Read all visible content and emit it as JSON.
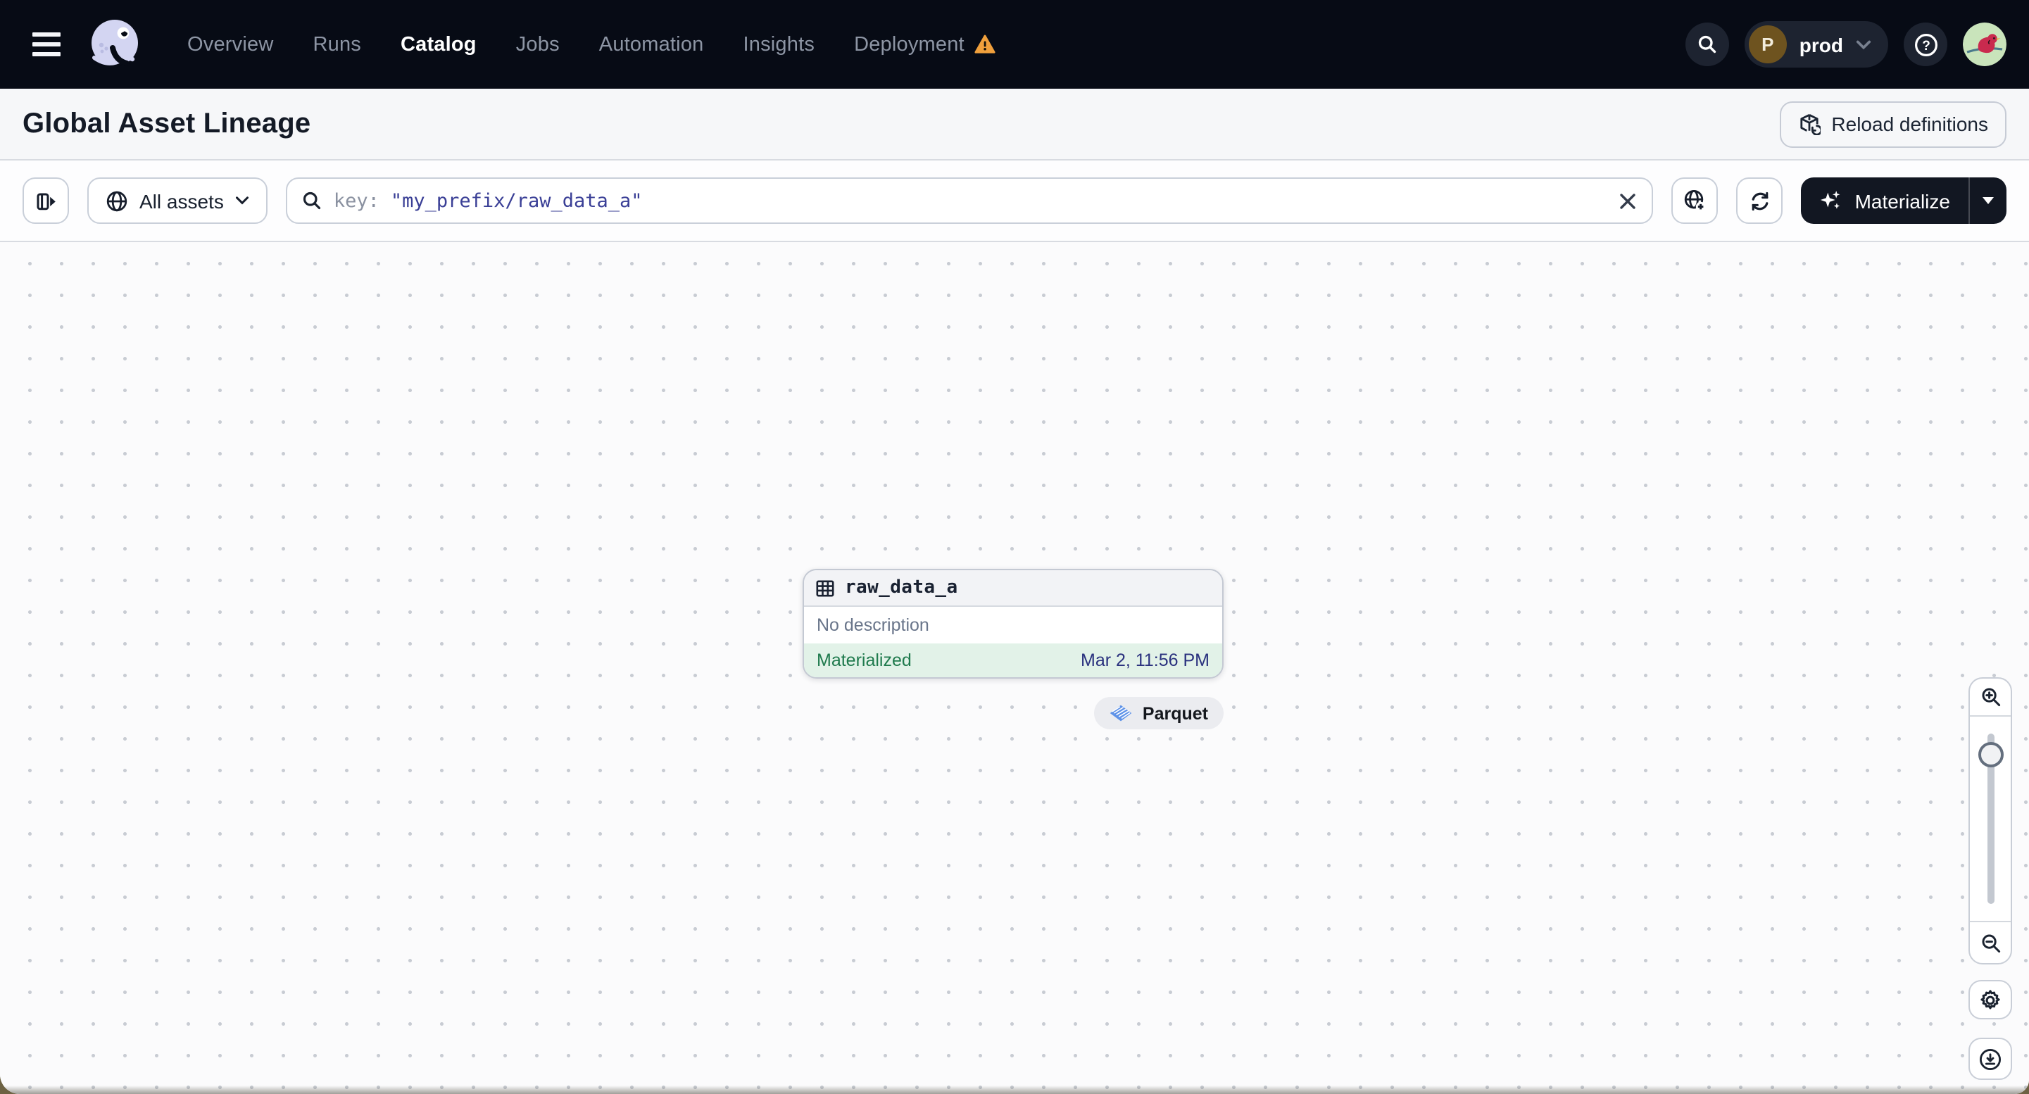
{
  "nav": {
    "links": [
      {
        "label": "Overview"
      },
      {
        "label": "Runs"
      },
      {
        "label": "Catalog"
      },
      {
        "label": "Jobs"
      },
      {
        "label": "Automation"
      },
      {
        "label": "Insights"
      },
      {
        "label": "Deployment"
      }
    ],
    "active_link": "Catalog",
    "env": {
      "initial": "P",
      "name": "prod"
    }
  },
  "header": {
    "title": "Global Asset Lineage",
    "reload_button_label": "Reload definitions"
  },
  "toolbar": {
    "filter_button_label": "All assets",
    "search_prefix": "key:",
    "search_value": "\"my_prefix/raw_data_a\"",
    "materialize_button_label": "Materialize"
  },
  "canvas": {
    "node": {
      "title": "raw_data_a",
      "description": "No description",
      "status": "Materialized",
      "status_timestamp": "Mar 2, 11:56 PM",
      "compute_kind_tag": "Parquet"
    }
  },
  "colors": {
    "nav_background": "#070b15",
    "materialized_green_bg": "#e2f2e8",
    "materialized_green_text": "#1f7a4d",
    "timestamp_navy": "#2a317e",
    "search_value_indigo": "#3a3f96",
    "warning_orange": "#f0a03c",
    "parquet_blue": "#5f93e8"
  }
}
